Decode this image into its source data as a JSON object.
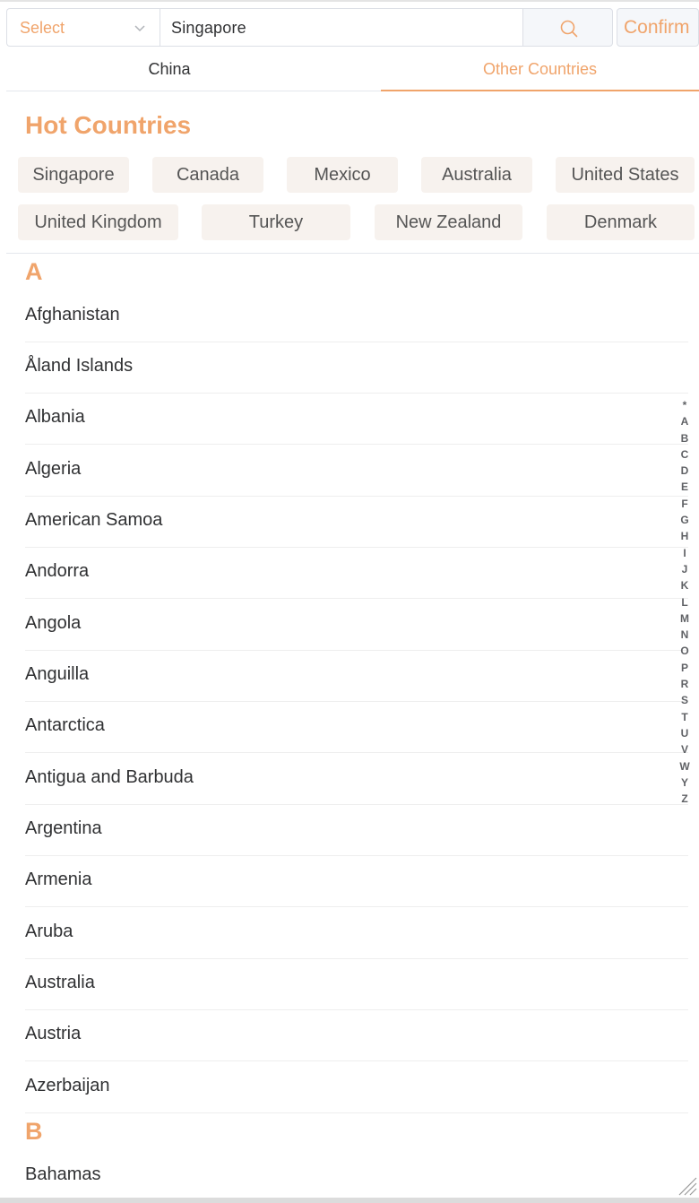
{
  "search": {
    "select_placeholder": "Select",
    "query": "Singapore",
    "confirm_label": "Confirm"
  },
  "tabs": [
    {
      "label": "China",
      "active": false
    },
    {
      "label": "Other Countries",
      "active": true
    }
  ],
  "hot": {
    "title": "Hot Countries",
    "items": [
      "Singapore",
      "Canada",
      "Mexico",
      "Australia",
      "United States",
      "United Kingdom",
      "Turkey",
      "New Zealand",
      "Denmark"
    ]
  },
  "groups": [
    {
      "letter": "A",
      "countries": [
        "Afghanistan",
        "Åland Islands",
        "Albania",
        "Algeria",
        "American Samoa",
        "Andorra",
        "Angola",
        "Anguilla",
        "Antarctica",
        "Antigua and Barbuda",
        "Argentina",
        "Armenia",
        "Aruba",
        "Australia",
        "Austria",
        "Azerbaijan"
      ]
    },
    {
      "letter": "B",
      "countries": [
        "Bahamas"
      ]
    }
  ],
  "index": [
    "*",
    "A",
    "B",
    "C",
    "D",
    "E",
    "F",
    "G",
    "H",
    "I",
    "J",
    "K",
    "L",
    "M",
    "N",
    "O",
    "P",
    "R",
    "S",
    "T",
    "U",
    "V",
    "W",
    "Y",
    "Z"
  ],
  "colors": {
    "accent": "#f0a46b",
    "chip_bg": "#f7f2ee",
    "text": "#303133"
  }
}
